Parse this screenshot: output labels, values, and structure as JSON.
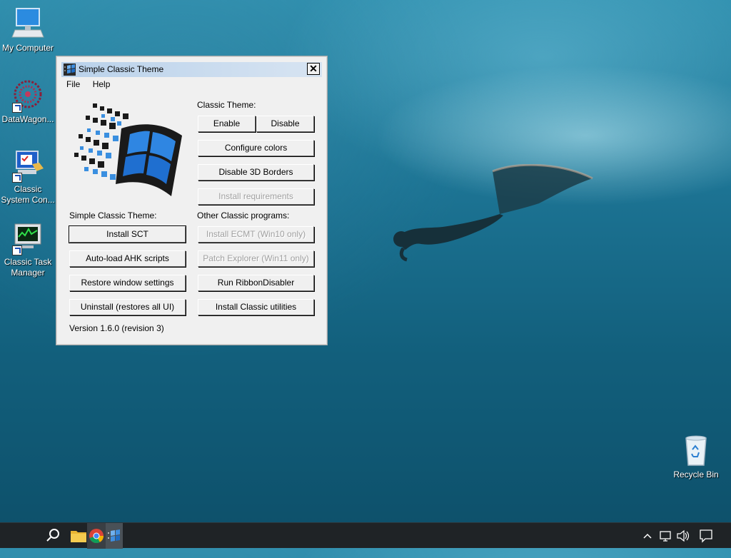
{
  "desktop": {
    "icons": [
      {
        "label": "My Computer"
      },
      {
        "label": "DataWagon..."
      },
      {
        "label": "Classic System Con..."
      },
      {
        "label": "Classic Task Manager"
      },
      {
        "label": "Recycle Bin"
      }
    ]
  },
  "window": {
    "title": "Simple Classic Theme",
    "close_glyph": "✕",
    "menu": {
      "file": "File",
      "help": "Help"
    },
    "classic_theme_label": "Classic Theme:",
    "sct_label": "Simple Classic Theme:",
    "other_label": "Other Classic programs:",
    "buttons": {
      "enable": "Enable",
      "disable": "Disable",
      "configure_colors": "Configure colors",
      "disable_3d": "Disable 3D Borders",
      "install_requirements": "Install requirements",
      "install_sct": "Install SCT",
      "autoload_ahk": "Auto-load AHK scripts",
      "restore_window": "Restore window settings",
      "uninstall": "Uninstall (restores all UI)",
      "install_ecmt": "Install ECMT (Win10 only)",
      "patch_explorer": "Patch Explorer (Win11 only)",
      "run_ribbon": "Run RibbonDisabler",
      "install_utilities": "Install Classic utilities"
    },
    "version": "Version 1.6.0 (revision 3)"
  },
  "taskbar": {
    "icons": [
      "search-icon",
      "file-explorer-icon",
      "chrome-icon",
      "simple-classic-theme-icon"
    ],
    "tray": [
      "chevron-up-icon",
      "network-icon",
      "volume-icon",
      "notification-icon"
    ]
  }
}
